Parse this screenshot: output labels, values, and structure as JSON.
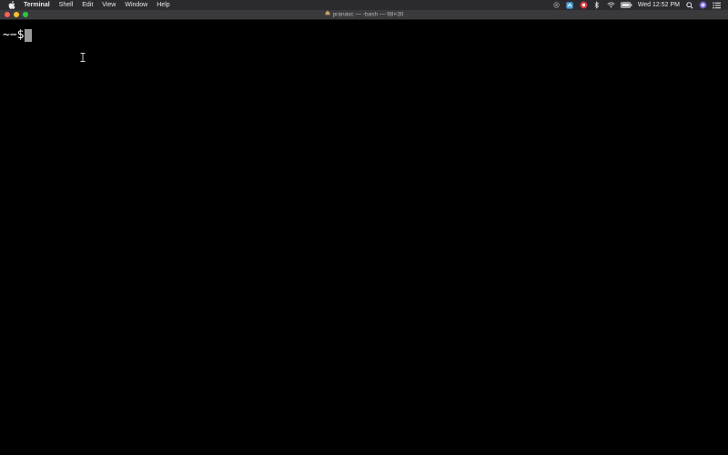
{
  "menubar": {
    "app_name": "Terminal",
    "items": [
      "Shell",
      "Edit",
      "View",
      "Window",
      "Help"
    ],
    "clock": "Wed 12:52 PM",
    "status_icons": [
      "screen-record-icon",
      "app-icon",
      "badge-app-icon",
      "bluetooth-icon",
      "wifi-icon",
      "battery-icon",
      "spotlight-search-icon",
      "siri-icon",
      "notification-center-icon"
    ]
  },
  "window": {
    "title": "pranavc — -bash — 98×30",
    "prompt": "~−$"
  },
  "colors": {
    "menubar_bg": "#2b2b2f",
    "titlebar_bg": "#3a3a3c",
    "terminal_bg": "#000000",
    "close": "#ff5f57",
    "minimize": "#febc2e",
    "maximize": "#28c840"
  }
}
